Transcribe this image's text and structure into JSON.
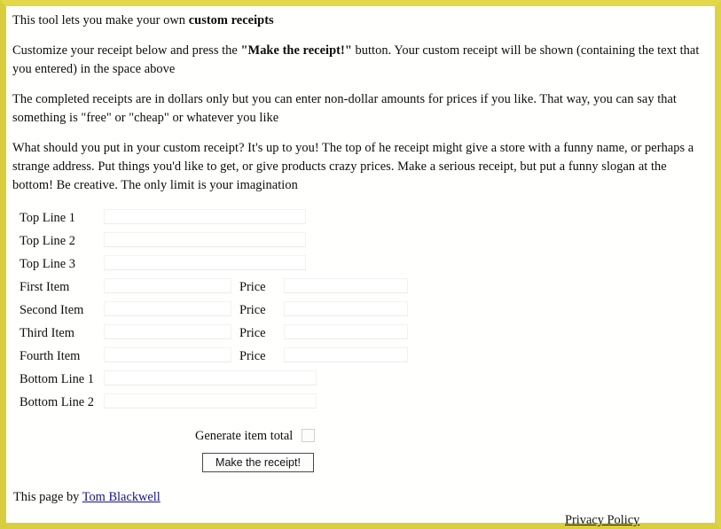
{
  "page": {
    "border_color": "#ddd344",
    "background_color": "#ffffff",
    "link_color": "#1111aa"
  },
  "intro": {
    "line1_pre": "This tool lets you make your own ",
    "line1_bold": "custom receipts",
    "para2_pre": "Customize your receipt below and press the ",
    "para2_bold": "\"Make the receipt!\"",
    "para2_post": " button. Your custom receipt will be shown (containing the text that you entered) in the space above",
    "para3": "The completed receipts are in dollars only but you can enter non-dollar amounts for prices if you like. That way, you can say that something is \"free\" or \"cheap\" or whatever you like",
    "para4": "What should you put in your custom receipt? It's up to you! The top of he receipt might give a store with a funny name, or perhaps a strange address. Put things you'd like to get, or give products crazy prices. Make a serious receipt, but put a funny slogan at the bottom! Be creative. The only limit is your imagination"
  },
  "form": {
    "top_lines": [
      {
        "label": "Top Line 1",
        "value": "",
        "placeholder": ""
      },
      {
        "label": "Top Line 2",
        "value": "",
        "placeholder": ""
      },
      {
        "label": "Top Line 3",
        "value": "",
        "placeholder": ""
      }
    ],
    "items": [
      {
        "label": "First Item",
        "price_label": "Price",
        "name_value": "",
        "price_value": ""
      },
      {
        "label": "Second Item",
        "price_label": "Price",
        "name_value": "",
        "price_value": ""
      },
      {
        "label": "Third Item",
        "price_label": "Price",
        "name_value": "",
        "price_value": ""
      },
      {
        "label": "Fourth Item",
        "price_label": "Price",
        "name_value": "",
        "price_value": ""
      }
    ],
    "bottom_lines": [
      {
        "label": "Bottom Line 1",
        "value": ""
      },
      {
        "label": "Bottom Line 2",
        "value": ""
      }
    ],
    "generate_total_label": "Generate item total",
    "generate_total_checked": false,
    "submit_label": "Make the receipt!"
  },
  "footer": {
    "byline_prefix": "This page by ",
    "author_link": "Tom Blackwell",
    "privacy_link": "Privacy Policy"
  }
}
